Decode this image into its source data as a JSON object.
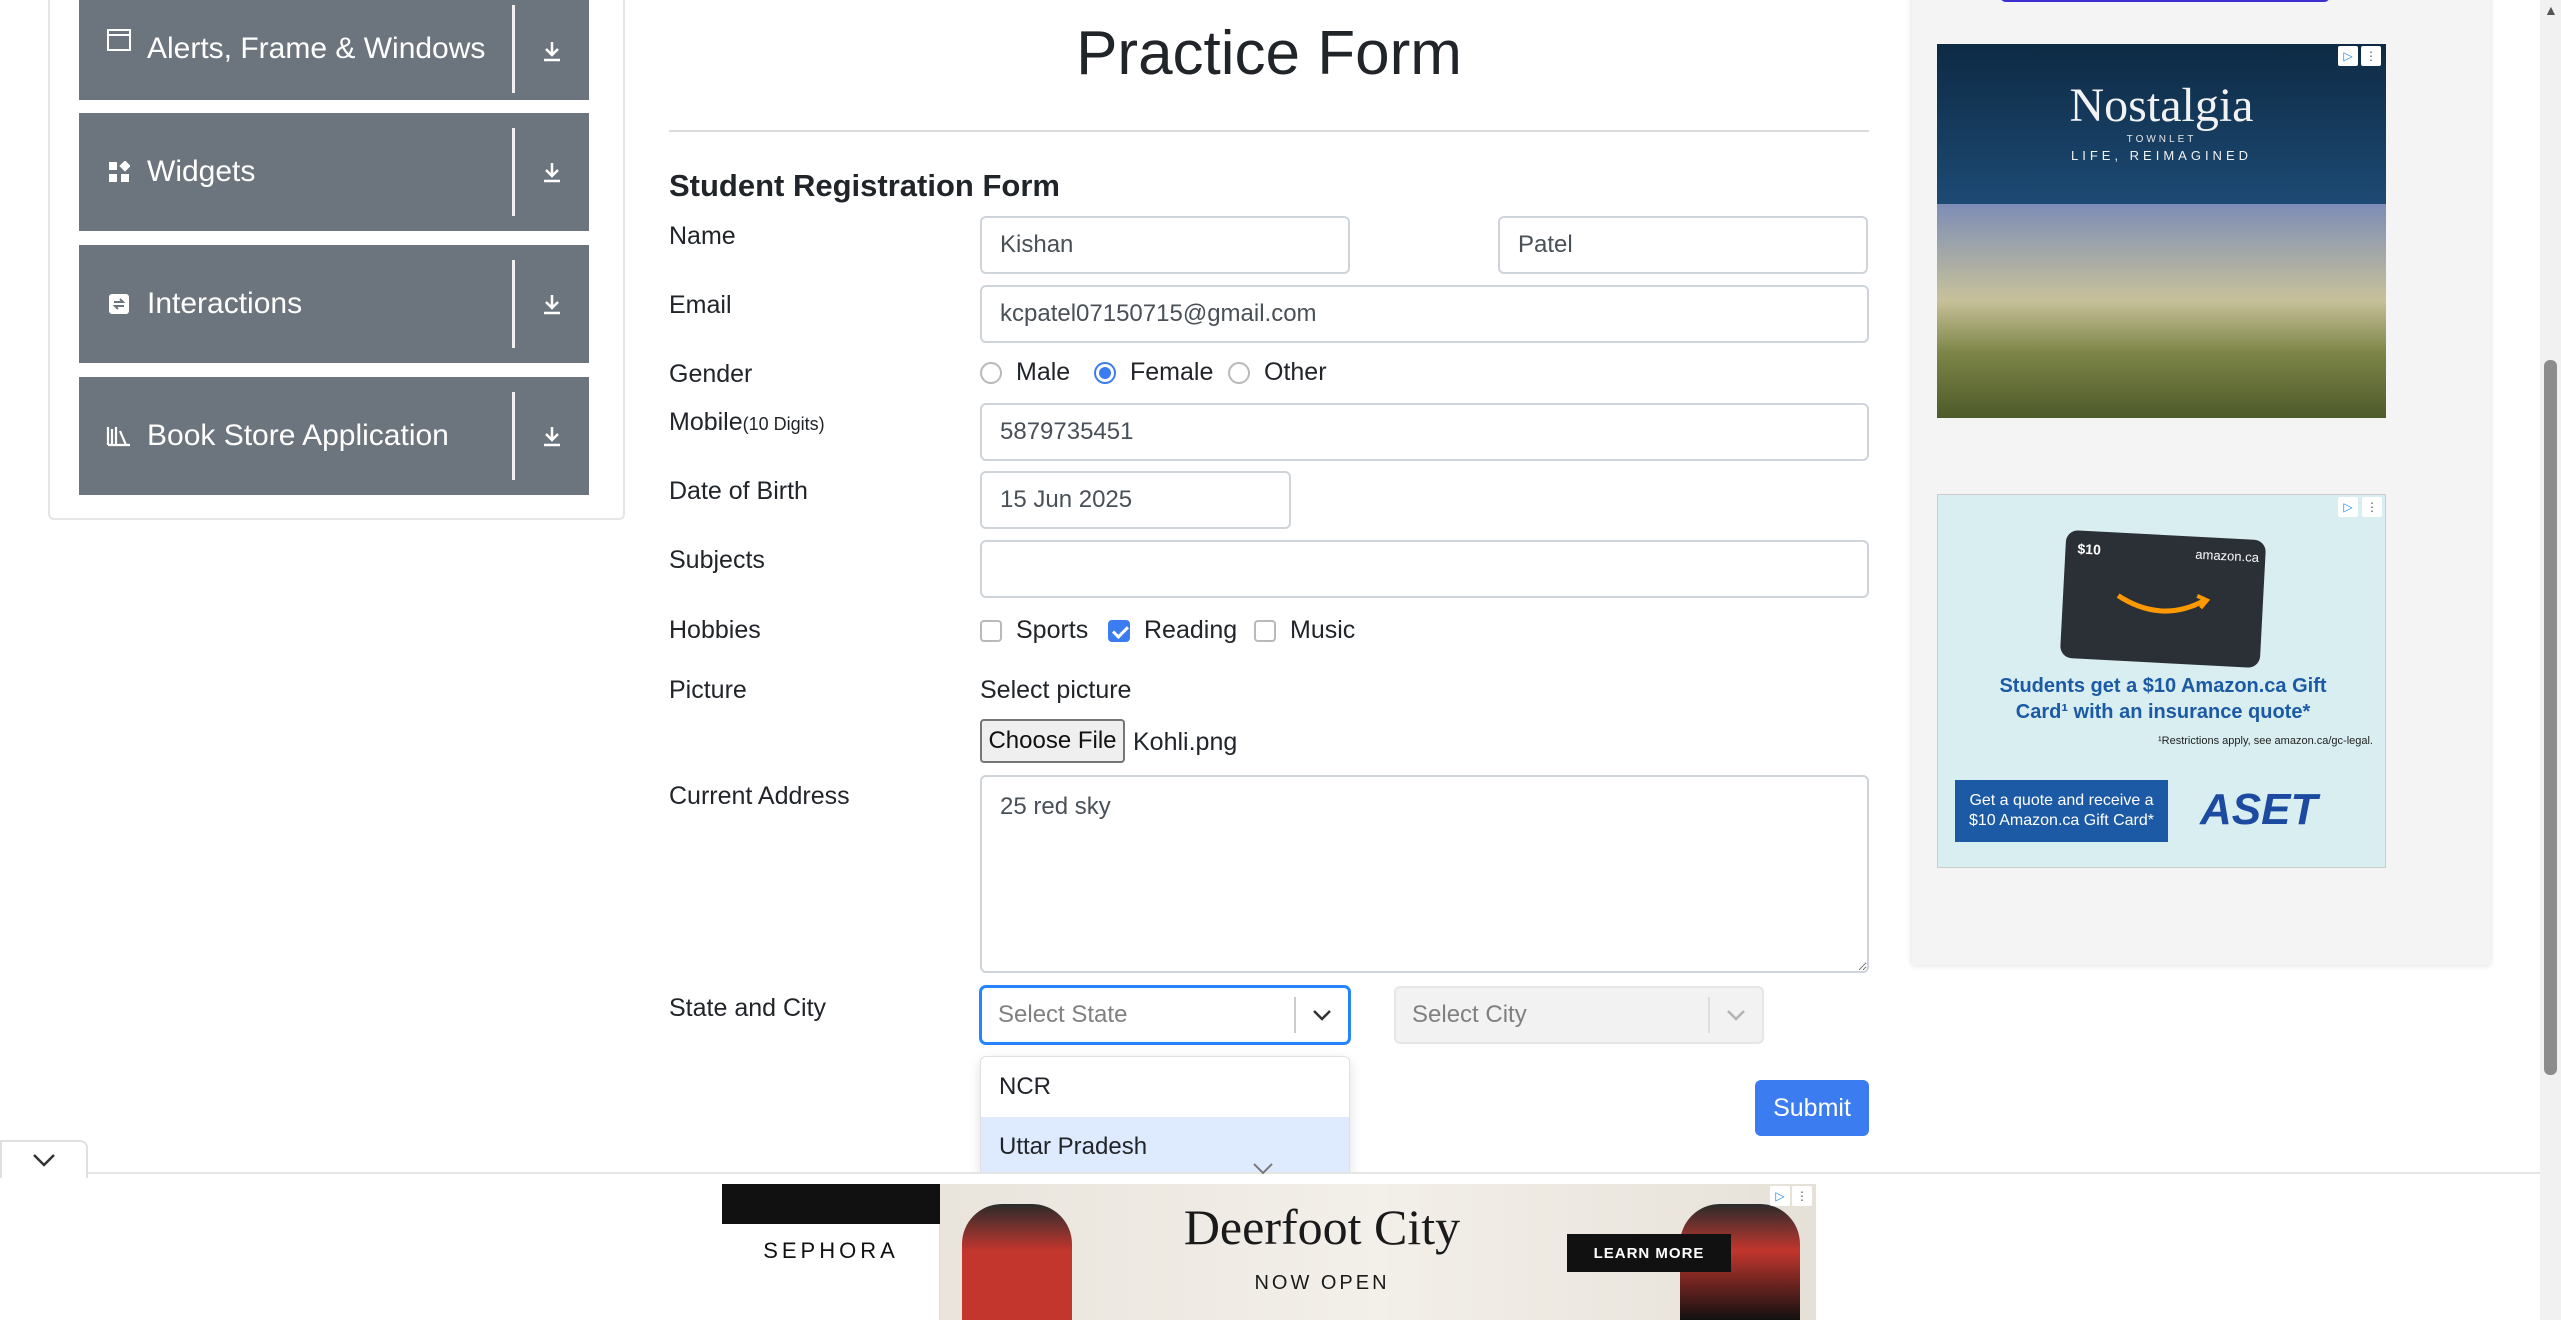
{
  "sidebar": {
    "groups": [
      {
        "label": "Alerts, Frame & Windows",
        "icon": "window-icon"
      },
      {
        "label": "Widgets",
        "icon": "widgets-icon"
      },
      {
        "label": "Interactions",
        "icon": "interactions-icon"
      },
      {
        "label": "Book Store Application",
        "icon": "book-icon"
      }
    ]
  },
  "page": {
    "title": "Practice Form",
    "form_title": "Student Registration Form"
  },
  "form": {
    "name_label": "Name",
    "first_name": "Kishan",
    "last_name": "Patel",
    "email_label": "Email",
    "email": "kcpatel07150715@gmail.com",
    "gender_label": "Gender",
    "gender_options": [
      "Male",
      "Female",
      "Other"
    ],
    "gender_selected": "Female",
    "mobile_label": "Mobile",
    "mobile_hint": "(10 Digits)",
    "mobile": "5879735451",
    "dob_label": "Date of Birth",
    "dob": "15 Jun 2025",
    "subjects_label": "Subjects",
    "subjects": "",
    "hobbies_label": "Hobbies",
    "hobbies": [
      "Sports",
      "Reading",
      "Music"
    ],
    "hobbies_checked": [
      "Reading"
    ],
    "picture_label": "Picture",
    "select_picture": "Select picture",
    "choose_file": "Choose File",
    "file_name": "Kohli.png",
    "address_label": "Current Address",
    "address": "25 red sky",
    "state_city_label": "State and City",
    "state_placeholder": "Select State",
    "city_placeholder": "Select City",
    "state_options": [
      "NCR",
      "Uttar Pradesh"
    ],
    "submit": "Submit"
  },
  "ads": {
    "right1": {
      "brand": "Nostalgia",
      "sub": "TOWNLET",
      "tagline": "LIFE, REIMAGINED"
    },
    "right2": {
      "card_value": "$10",
      "card_brand": "amazon.ca",
      "headline": "Students get a $10 Amazon.ca Gift Card¹ with an insurance quote*",
      "fine_print": "¹Restrictions apply, see amazon.ca/gc-legal.",
      "cta": "Get a quote and receive a $10 Amazon.ca Gift Card*",
      "logo": "ASET"
    },
    "bottom": {
      "brand": "SEPHORA",
      "headline": "Deerfoot City",
      "sub": "NOW OPEN",
      "cta": "LEARN MORE"
    }
  },
  "colors": {
    "sidebar_bg": "#6c757d",
    "accent": "#3b7cf0",
    "focus_border": "#2684ff"
  }
}
